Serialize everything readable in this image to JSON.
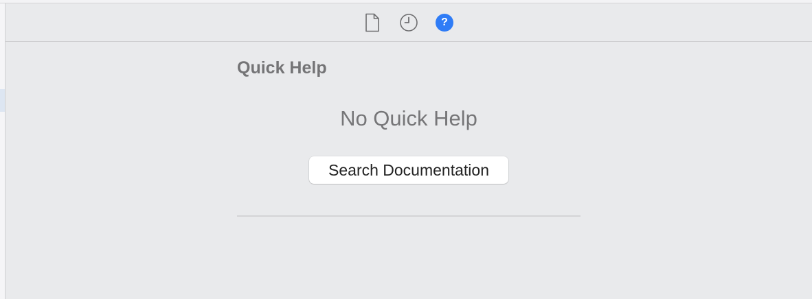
{
  "toolbar": {
    "icons": [
      "file-icon",
      "history-icon",
      "help-icon"
    ],
    "help_glyph": "?",
    "accent_color": "#2f7cf6"
  },
  "quick_help": {
    "title": "Quick Help",
    "empty_message": "No Quick Help",
    "search_button_label": "Search Documentation"
  }
}
